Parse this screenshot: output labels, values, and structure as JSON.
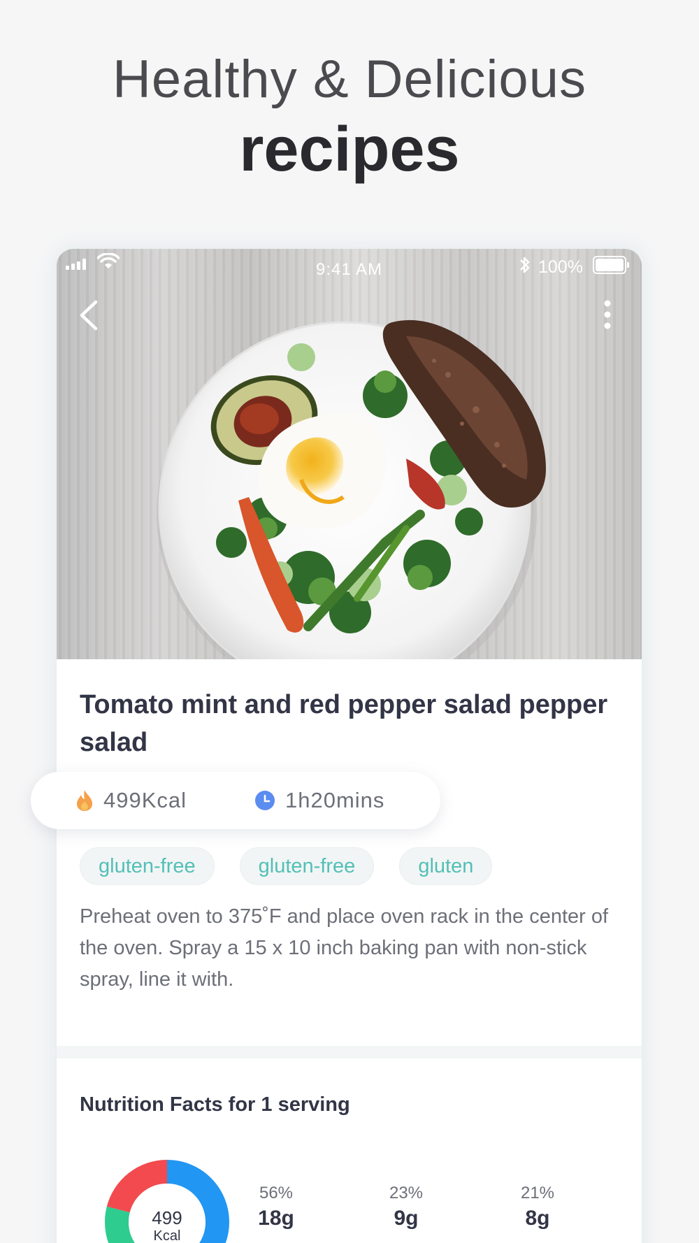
{
  "hero": {
    "line1": "Healthy & Delicious",
    "line2": "recipes"
  },
  "status_bar": {
    "time": "9:41 AM",
    "battery": "100%"
  },
  "nav": {
    "back_icon": "chevron-left-icon",
    "menu_icon": "vertical-dots-icon"
  },
  "recipe": {
    "title": "Tomato mint and red pepper salad pepper salad",
    "calories": "499Kcal",
    "duration": "1h20mins",
    "tags": [
      "gluten-free",
      "gluten-free",
      "gluten"
    ],
    "description": "Preheat oven to 375˚F and place oven rack in the center of the oven.  Spray a 15 x 10 inch baking pan with non-stick spray, line it with."
  },
  "nutrition": {
    "title": "Nutrition Facts for 1 serving",
    "total_value": "499",
    "total_unit": "Kcal",
    "nutrients": [
      {
        "percent": "56%",
        "grams": "18g",
        "color": "#2196f3"
      },
      {
        "percent": "23%",
        "grams": "9g",
        "color": "#2ecc8f"
      },
      {
        "percent": "21%",
        "grams": "8g",
        "color": "#f24a4f"
      }
    ]
  },
  "colors": {
    "tag_text": "#52c0b7",
    "flame": "#f5a04a",
    "clock": "#5b8cf0"
  }
}
